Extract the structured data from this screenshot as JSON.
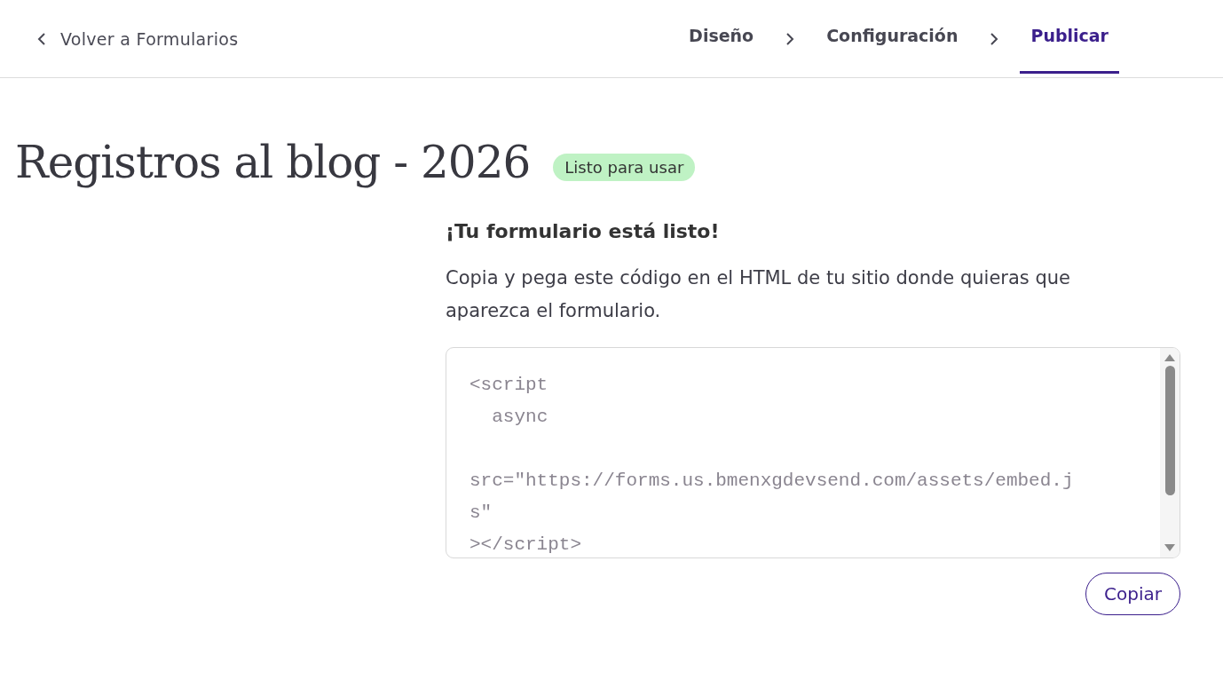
{
  "back_link": {
    "label": "Volver a Formularios"
  },
  "steps": [
    {
      "label": "Diseño",
      "selected": false
    },
    {
      "label": "Configuración",
      "selected": false
    },
    {
      "label": "Publicar",
      "selected": true
    }
  ],
  "title": "Registros al blog - 2026",
  "status_badge": "Listo para usar",
  "heading": "¡Tu formulario está listo!",
  "description": "Copia y pega este código en el HTML de tu sitio donde quieras que aparezca el formulario.",
  "embed_code": "<script\n  async\n\nsrc=\"https://forms.us.bmenxgdevsend.com/assets/embed.js\"\n></script>",
  "copy_button": "Copiar"
}
